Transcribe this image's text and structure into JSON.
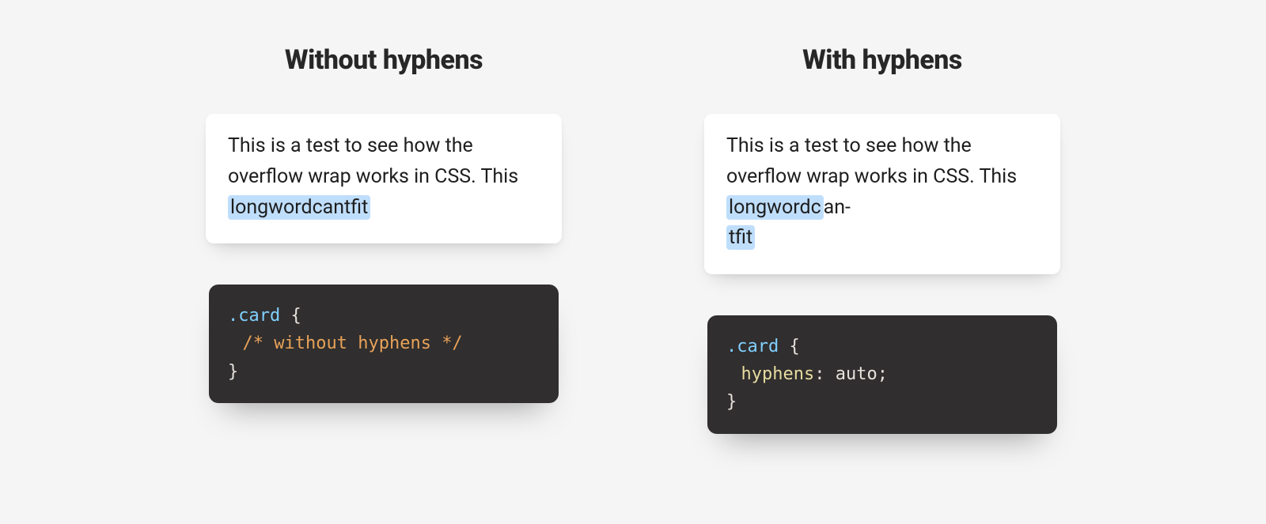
{
  "left": {
    "heading": "Without hyphens",
    "card_text_before": "This is a test to see how the overflow wrap works in CSS. This ",
    "card_highlight": "longwordcantfit",
    "card_text_after": "",
    "code": {
      "selector": ".card",
      "open_brace": " {",
      "body_kind": "comment",
      "comment": "/* without hyphens */",
      "close_brace": "}"
    }
  },
  "right": {
    "heading": "With hyphens",
    "card_text_before": "This is a test to see how the overflow wrap works in CSS. This ",
    "card_hl_1": "longwordc",
    "card_mid": "an-",
    "card_hl_2": "tfit",
    "code": {
      "selector": ".card",
      "open_brace": " {",
      "body_kind": "decl",
      "prop": "hyphens",
      "colon_val": ": auto;",
      "close_brace": "}"
    }
  }
}
